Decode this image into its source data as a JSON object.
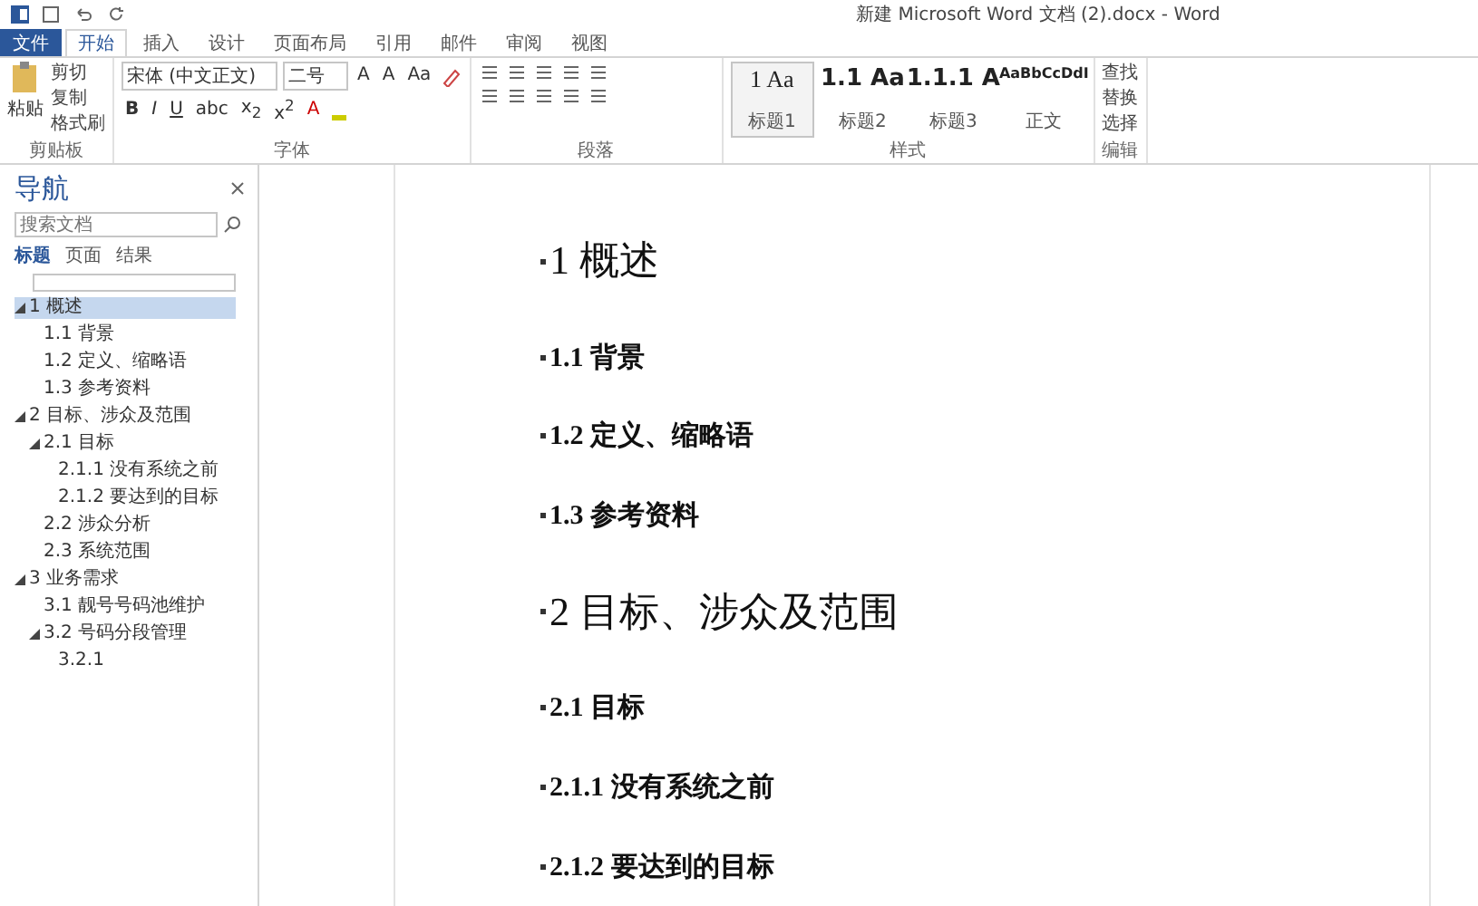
{
  "window": {
    "title": "新建 Microsoft Word 文档 (2).docx - Word"
  },
  "tabs": [
    {
      "label": "文件",
      "kind": "file",
      "selected": false
    },
    {
      "label": "开始",
      "kind": "tab",
      "selected": true
    },
    {
      "label": "插入",
      "kind": "tab",
      "selected": false
    },
    {
      "label": "设计",
      "kind": "tab",
      "selected": false
    },
    {
      "label": "页面布局",
      "kind": "tab",
      "selected": false
    },
    {
      "label": "引用",
      "kind": "tab",
      "selected": false
    },
    {
      "label": "邮件",
      "kind": "tab",
      "selected": false
    },
    {
      "label": "审阅",
      "kind": "tab",
      "selected": false
    },
    {
      "label": "视图",
      "kind": "tab",
      "selected": false
    }
  ],
  "ribbon": {
    "clipboard": {
      "paste": "粘贴",
      "items": [
        "剪切",
        "复制",
        "格式刷"
      ],
      "label": "剪贴板"
    },
    "font": {
      "family": "宋体 (中文正文)",
      "size": "二号",
      "row1": [
        "A",
        "A",
        "Aa"
      ],
      "row2": [
        "B",
        "I",
        "U",
        "abc",
        "x$_{2}$",
        "x$^{2}$",
        "A"
      ],
      "label": "字体"
    },
    "paragraph": {
      "label": "段落"
    },
    "styles": {
      "label": "样式",
      "items": [
        {
          "sample": "1 Aa",
          "name": "标题1",
          "selected": true
        },
        {
          "sample": "1.1 Aa",
          "name": "标题2",
          "selected": false
        },
        {
          "sample": "1.1.1 A",
          "name": "标题3",
          "selected": false
        },
        {
          "sample": "AaBbCcDdI",
          "name": "正文",
          "selected": false
        }
      ]
    },
    "editing": {
      "label": "编辑",
      "items": [
        "查找",
        "替换",
        "选择"
      ]
    }
  },
  "navigation": {
    "title": "导航",
    "search": {
      "placeholder": "搜索文档"
    },
    "tabs": [
      {
        "label": "标题",
        "selected": true
      },
      {
        "label": "页面",
        "selected": false
      },
      {
        "label": "结果",
        "selected": false
      }
    ],
    "tree": [
      {
        "label": "1 概述",
        "selected": true,
        "expanded": true,
        "children": [
          {
            "label": "1.1 背景",
            "selected": false
          },
          {
            "label": "1.2 定义、缩略语",
            "selected": false
          },
          {
            "label": "1.3 参考资料",
            "selected": false
          }
        ]
      },
      {
        "label": "2 目标、涉众及范围",
        "selected": false,
        "expanded": true,
        "children": [
          {
            "label": "2.1 目标",
            "selected": false,
            "expanded": true,
            "children": [
              {
                "label": "2.1.1 没有系统之前",
                "selected": false
              },
              {
                "label": "2.1.2 要达到的目标",
                "selected": false
              }
            ]
          },
          {
            "label": "2.2 涉众分析",
            "selected": false
          },
          {
            "label": "2.3 系统范围",
            "selected": false
          }
        ]
      },
      {
        "label": "3 业务需求",
        "selected": false,
        "expanded": true,
        "children": [
          {
            "label": "3.1 靓号号码池维护",
            "selected": false
          },
          {
            "label": "3.2 号码分段管理",
            "selected": false,
            "expanded": true,
            "children": [
              {
                "label": "3.2.1",
                "selected": false
              }
            ]
          }
        ]
      }
    ]
  },
  "document": {
    "headings": [
      {
        "kind": "h1",
        "text": "1 概述"
      },
      {
        "kind": "h2",
        "text": "1.1 背景"
      },
      {
        "kind": "h2",
        "text": "1.2 定义、缩略语"
      },
      {
        "kind": "h2",
        "text": "1.3 参考资料"
      },
      {
        "kind": "h1",
        "text": "2 目标、涉众及范围"
      },
      {
        "kind": "h2",
        "text": "2.1 目标"
      },
      {
        "kind": "h3",
        "text": "2.1.1 没有系统之前"
      },
      {
        "kind": "h3",
        "text": "2.1.2 要达到的目标"
      }
    ]
  }
}
